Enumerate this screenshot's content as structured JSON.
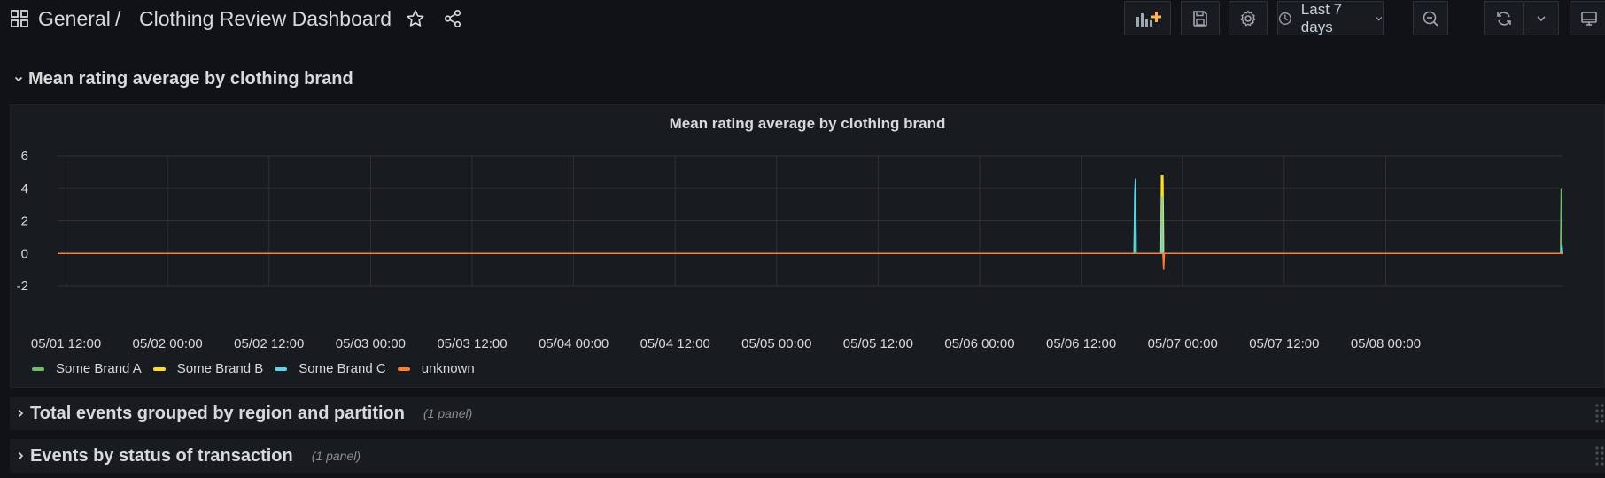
{
  "breadcrumb": {
    "folder": "General",
    "separator": "/",
    "title": "Clothing Review Dashboard"
  },
  "toolbar": {
    "time_range": "Last 7 days"
  },
  "rows": [
    {
      "title": "Mean rating average by clothing brand",
      "expanded": true
    },
    {
      "title": "Total events grouped by region and partition",
      "count": "(1 panel)",
      "expanded": false
    },
    {
      "title": "Events by status of transaction",
      "count": "(1 panel)",
      "expanded": false
    }
  ],
  "panel": {
    "title": "Mean rating average by clothing brand"
  },
  "colors": {
    "Some Brand A": "#73bf69",
    "Some Brand B": "#fade2a",
    "Some Brand C": "#5fd5e8",
    "unknown": "#ff7f2f"
  },
  "chart_data": {
    "type": "line",
    "title": "Mean rating average by clothing brand",
    "ylim": [
      -2,
      6
    ],
    "yticks": [
      -2,
      0,
      2,
      4,
      6
    ],
    "xlim": [
      "2025-05-01T11:00",
      "2025-05-08T21:00"
    ],
    "xticks": [
      "05/01 12:00",
      "05/02 00:00",
      "05/02 12:00",
      "05/03 00:00",
      "05/03 12:00",
      "05/04 00:00",
      "05/04 12:00",
      "05/05 00:00",
      "05/05 12:00",
      "05/06 00:00",
      "05/06 12:00",
      "05/07 00:00",
      "05/07 12:00",
      "05/08 00:00"
    ],
    "grid": true,
    "legend_placement": "bottom-left",
    "series": [
      {
        "name": "Some Brand A",
        "color": "#73bf69",
        "points": [
          [
            "05/06 18:15",
            0
          ],
          [
            "05/06 18:20",
            2.0
          ],
          [
            "05/06 18:25",
            0
          ],
          [
            "05/06 21:30",
            0
          ],
          [
            "05/06 21:35",
            4.0
          ],
          [
            "05/06 21:40",
            0
          ],
          [
            "05/08 20:40",
            0
          ],
          [
            "05/08 20:45",
            4.0
          ],
          [
            "05/08 20:50",
            0
          ]
        ]
      },
      {
        "name": "Some Brand B",
        "color": "#fade2a",
        "points": [
          [
            "05/06 21:25",
            0
          ],
          [
            "05/06 21:30",
            4.8
          ],
          [
            "05/06 21:35",
            0
          ],
          [
            "05/06 21:40",
            4.8
          ],
          [
            "05/06 21:45",
            0
          ]
        ]
      },
      {
        "name": "Some Brand C",
        "color": "#5fd5e8",
        "points": [
          [
            "05/06 18:15",
            0
          ],
          [
            "05/06 18:20",
            3.7
          ],
          [
            "05/06 18:25",
            4.6
          ],
          [
            "05/06 18:30",
            0
          ],
          [
            "05/06 21:30",
            0
          ],
          [
            "05/06 21:35",
            3.5
          ],
          [
            "05/06 21:40",
            0
          ],
          [
            "05/08 20:45",
            0
          ],
          [
            "05/08 20:50",
            0.5
          ],
          [
            "05/08 20:55",
            0
          ]
        ]
      },
      {
        "name": "unknown",
        "color": "#ff7f2f",
        "points": [
          [
            "05/06 21:40",
            0
          ],
          [
            "05/06 21:45",
            -1.0
          ],
          [
            "05/06 21:50",
            0
          ]
        ]
      }
    ]
  }
}
